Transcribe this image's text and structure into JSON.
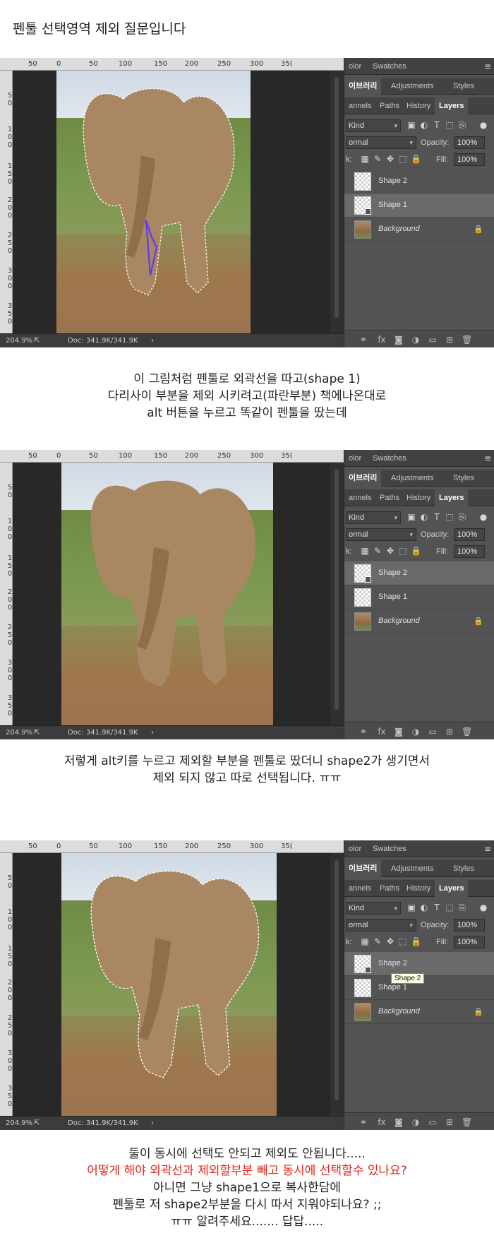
{
  "post": {
    "title": "펜툴 선택영역 제외 질문입니다",
    "caption1": [
      "이 그림처럼 펜툴로 외곽선을 따고(shape 1)",
      "다리사이 부분을 제외 시키려고(파란부분) 책에나온대로",
      "alt 버튼을 누르고 똑같이 펜툴을 땄는데"
    ],
    "caption2": [
      "저렇게 alt키를 누르고 제외할 부분을 펜툴로 땄더니 shape2가 생기면서",
      "제외 되지 않고 따로 선택됩니다. ㅠㅠ"
    ],
    "caption3": [
      "둘이 동시에 선택도 안되고  제외도 안됩니다.....",
      "어떻게 해야 외곽선과 제외할부분 빼고 동시에 선택할수 있나요?",
      "아니면 그냥 shape1으로 복사한담에",
      "펜툴로 저 shape2부분을 다시 따서 지워야되나요? ;;",
      "ㅠㅠ 알려주세요....... 답답....."
    ]
  },
  "photoshop": {
    "ruler_top": [
      "50",
      "0",
      "50",
      "100",
      "150",
      "200",
      "250",
      "300",
      "35("
    ],
    "ruler_left": [
      [
        "5",
        "0"
      ],
      [
        "1",
        "0",
        "0"
      ],
      [
        "1",
        "5",
        "0"
      ],
      [
        "2",
        "0",
        "0"
      ],
      [
        "2",
        "5",
        "0"
      ],
      [
        "3",
        "0",
        "0"
      ],
      [
        "3",
        "5",
        "0"
      ]
    ],
    "zoom": "204.9%",
    "doc_size": "Doc: 341.9K/341.9K",
    "status_arrow": "›",
    "panel_tabs_1": [
      "olor",
      "Swatches"
    ],
    "panel_tabs_2": [
      "이브러리",
      "Adjustments",
      "Styles"
    ],
    "panel_tabs_3": [
      "annels",
      "Paths",
      "History",
      "Layers"
    ],
    "filter_kind": "Kind",
    "blend_mode": "ormal",
    "opacity_label": "Opacity:",
    "opacity_value": "100%",
    "lock_label": "k:",
    "fill_label": "Fill:",
    "fill_value": "100%",
    "layers": [
      "Shape 2",
      "Shape 1",
      "Background"
    ],
    "tooltip": "Shape 2",
    "footer_fx": "fx"
  },
  "colors": {
    "selection_path": "#5a3df0",
    "caption_highlight": "#e0271c",
    "panel_bg": "#535353"
  }
}
